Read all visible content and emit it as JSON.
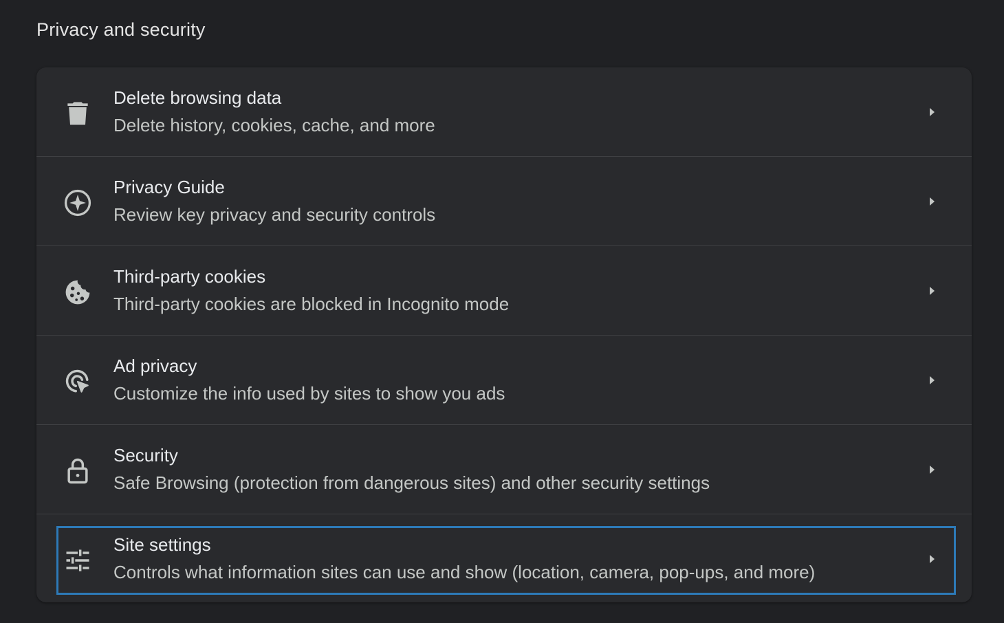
{
  "section": {
    "title": "Privacy and security"
  },
  "items": [
    {
      "icon": "trash-icon",
      "title": "Delete browsing data",
      "subtitle": "Delete history, cookies, cache, and more"
    },
    {
      "icon": "compass-icon",
      "title": "Privacy Guide",
      "subtitle": "Review key privacy and security controls"
    },
    {
      "icon": "cookie-icon",
      "title": "Third-party cookies",
      "subtitle": "Third-party cookies are blocked in Incognito mode"
    },
    {
      "icon": "ad-privacy-icon",
      "title": "Ad privacy",
      "subtitle": "Customize the info used by sites to show you ads"
    },
    {
      "icon": "lock-icon",
      "title": "Security",
      "subtitle": "Safe Browsing (protection from dangerous sites) and other security settings"
    },
    {
      "icon": "sliders-icon",
      "title": "Site settings",
      "subtitle": "Controls what information sites can use and show (location, camera, pop-ups, and more)",
      "focused": true
    }
  ],
  "colors": {
    "background": "#202124",
    "card": "#292a2d",
    "focus_ring": "#2d7ab8",
    "icon": "#c4c7c5"
  }
}
